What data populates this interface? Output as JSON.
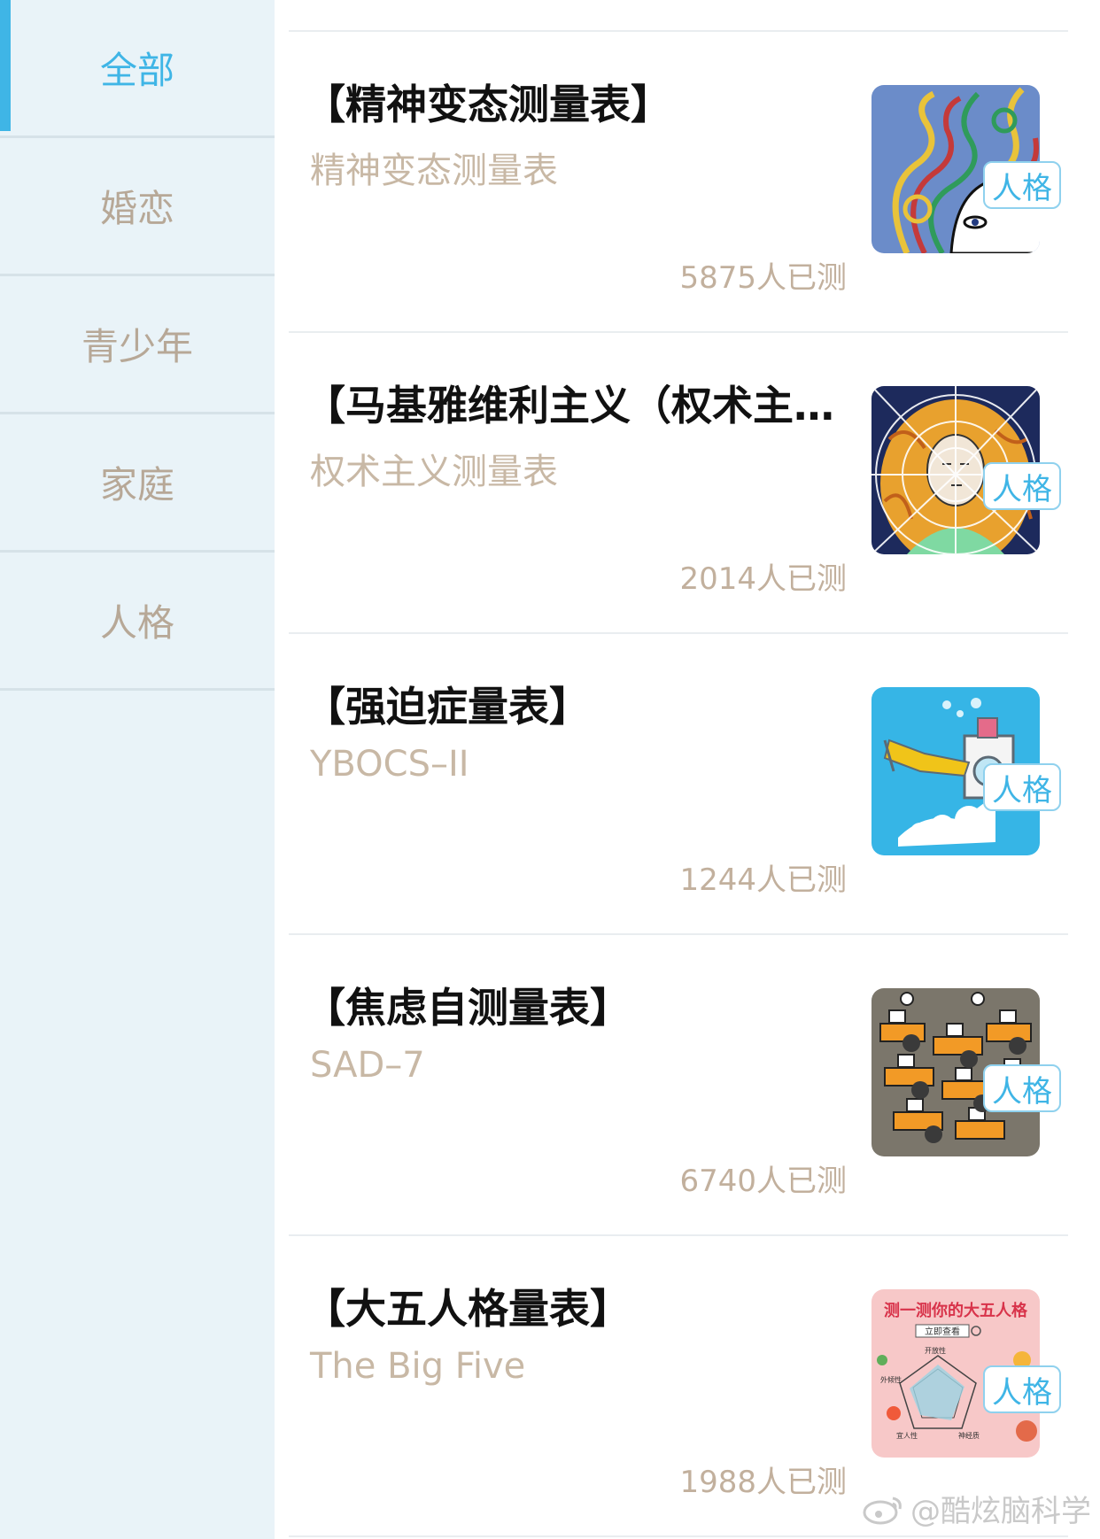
{
  "sidebar": {
    "categories": [
      {
        "label": "全部",
        "active": true
      },
      {
        "label": "婚恋",
        "active": false
      },
      {
        "label": "青少年",
        "active": false
      },
      {
        "label": "家庭",
        "active": false
      },
      {
        "label": "人格",
        "active": false
      }
    ]
  },
  "tests": [
    {
      "title": "【精神变态测量表】",
      "subtitle": "精神变态测量表",
      "count": "5875人已测",
      "tag": "人格",
      "image": "hair-swirl-face-illustration"
    },
    {
      "title": "【马基雅维利主义（权术主义测量表）】",
      "subtitle": "权术主义测量表",
      "count": "2014人已测",
      "tag": "人格",
      "image": "woman-in-spiderweb-illustration"
    },
    {
      "title": "【强迫症量表】",
      "subtitle": "YBOCS–II",
      "count": "1244人已测",
      "tag": "人格",
      "image": "washing-machine-illustration"
    },
    {
      "title": "【焦虑自测量表】",
      "subtitle": "SAD–7",
      "count": "6740人已测",
      "tag": "人格",
      "image": "crowded-office-illustration"
    },
    {
      "title": "【大五人格量表】",
      "subtitle": "The Big Five",
      "count": "1988人已测",
      "tag": "人格",
      "image": "big-five-radar-poster"
    }
  ],
  "thumbnail_text": {
    "big_five_heading": "测一测你的大五人格",
    "big_five_button": "立即查看",
    "big_five_traits": [
      "开放性",
      "外倾性",
      "宜人性",
      "神经质"
    ]
  },
  "watermark": "@酷炫脑科学",
  "colors": {
    "accent": "#3fb5e6",
    "sidebar_bg": "#e9f3f8",
    "muted_text": "#c2b09d"
  }
}
